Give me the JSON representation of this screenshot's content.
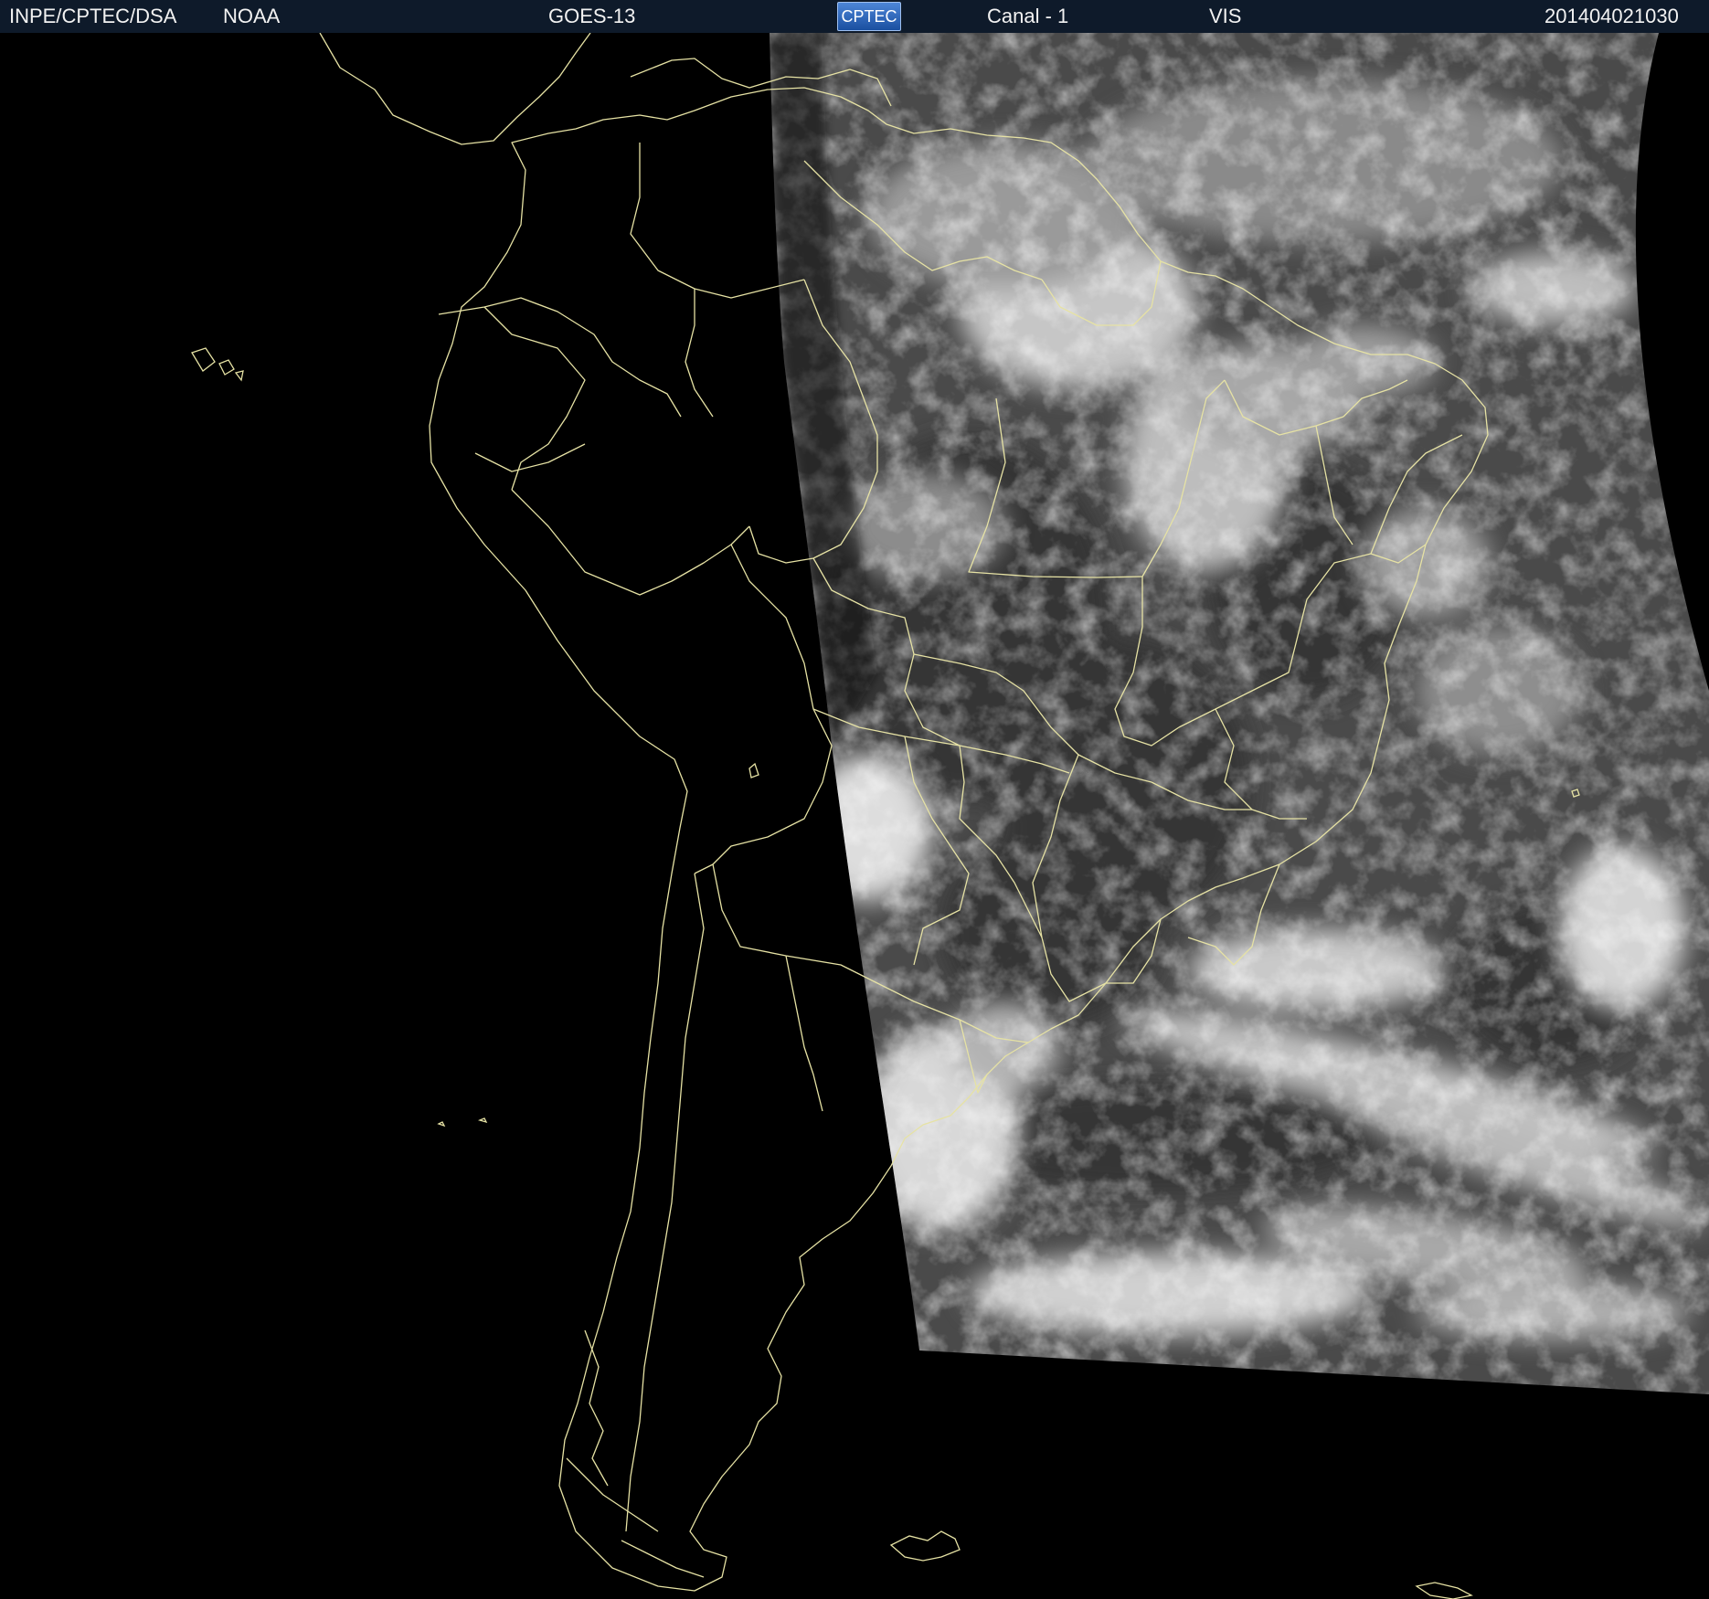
{
  "header": {
    "institution": "INPE/CPTEC/DSA",
    "agency": "NOAA",
    "satellite": "GOES-13",
    "logo_text": "CPTEC",
    "channel": "Canal - 1",
    "band": "VIS",
    "timestamp": "201404021030"
  },
  "colors": {
    "header_background": "#0e1a2a",
    "header_text": "#f2f2f2",
    "border_lines": "#e6e2a4",
    "space_background": "#000000",
    "ocean_gray": "#4a4a4a",
    "cloud_white": "#d8d8d8"
  }
}
